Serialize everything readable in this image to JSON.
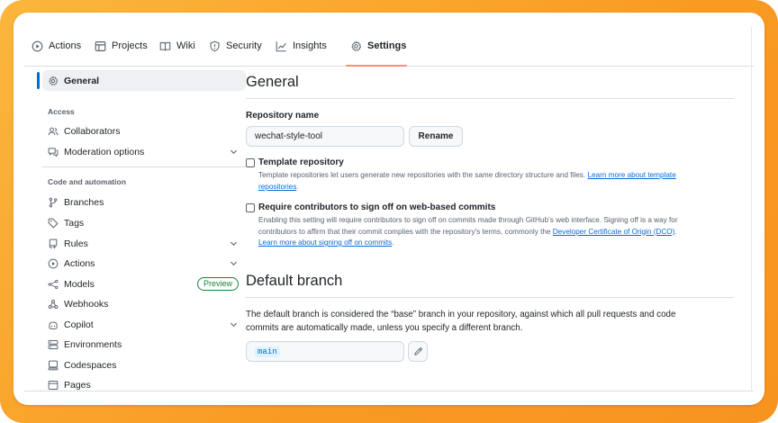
{
  "tabs": [
    {
      "label": "Actions",
      "icon": "play-icon"
    },
    {
      "label": "Projects",
      "icon": "table-icon"
    },
    {
      "label": "Wiki",
      "icon": "book-icon"
    },
    {
      "label": "Security",
      "icon": "shield-icon"
    },
    {
      "label": "Insights",
      "icon": "graph-icon"
    },
    {
      "label": "Settings",
      "icon": "gear-icon",
      "active": true
    }
  ],
  "sidebar": {
    "general": "General",
    "access_header": "Access",
    "collaborators": "Collaborators",
    "moderation": "Moderation options",
    "code_header": "Code and automation",
    "branches": "Branches",
    "tags": "Tags",
    "rules": "Rules",
    "actions": "Actions",
    "models": "Models",
    "models_badge": "Preview",
    "webhooks": "Webhooks",
    "copilot": "Copilot",
    "environments": "Environments",
    "codespaces": "Codespaces",
    "pages": "Pages"
  },
  "general": {
    "title": "General",
    "repo_name_label": "Repository name",
    "repo_name_value": "wechat-style-tool",
    "rename_label": "Rename",
    "template": {
      "label": "Template repository",
      "desc": "Template repositories let users generate new repositories with the same directory structure and files.",
      "link_a": "Learn more about template",
      "link_b": "repositories",
      "tail": "."
    },
    "signoff": {
      "label": "Require contributors to sign off on web-based commits",
      "desc_1": "Enabling this setting will require contributors to sign off on commits made through GitHub’s web interface. Signing off is a way for",
      "desc_2": "contributors to affirm that their commit complies with the repository's terms, commonly the",
      "dco_link": "Developer Certificate of Origin (DCO)",
      "dco_tail": ".",
      "learn_link": "Learn more about signing off on commits",
      "learn_tail": "."
    }
  },
  "default_branch": {
    "title": "Default branch",
    "desc_1": "The default branch is considered the “base” branch in your repository, against which all pull requests and code",
    "desc_2": "commits are automatically made, unless you specify a different branch.",
    "branch_value": "main"
  },
  "colors": {
    "frame": "#f99a22",
    "accent_underline": "#fd8c73",
    "link": "#0969da",
    "badge": "#1a7f37"
  }
}
